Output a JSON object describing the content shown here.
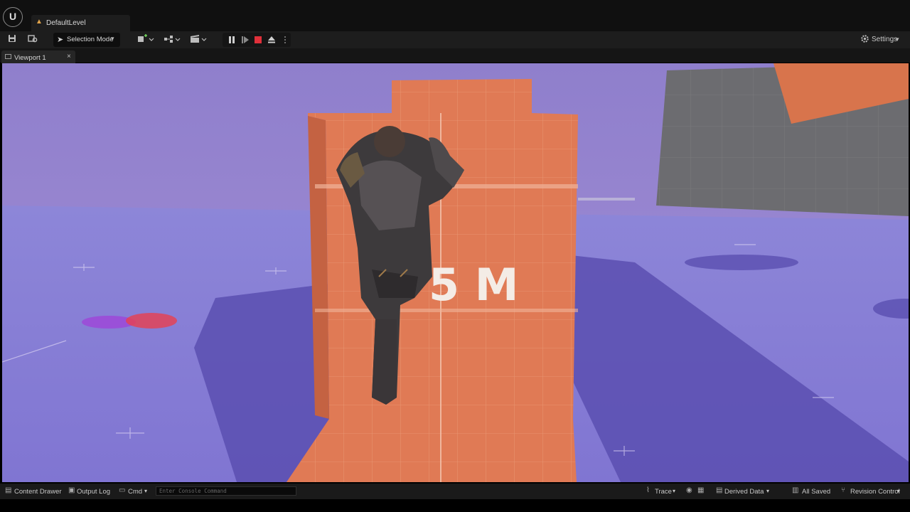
{
  "app": {
    "logo_text": "U",
    "level_title": "DefaultLevel"
  },
  "toolbar": {
    "mode_label": "Selection Mode",
    "settings_label": "Settings"
  },
  "viewport": {
    "tab_label": "Viewport 1",
    "close_glyph": "×",
    "sign_text": "5 M"
  },
  "statusbar": {
    "content_drawer": "Content Drawer",
    "output_log": "Output Log",
    "cmd": "Cmd",
    "console_placeholder": "Enter Console Command",
    "trace": "Trace",
    "derived_data": "Derived Data",
    "all_saved": "All Saved",
    "revision_control": "Revision Control"
  },
  "colors": {
    "floor": "#8a7fd6",
    "sky": "#9a84cf",
    "wall": "#e07a55",
    "stop": "#e0303a",
    "warning": "#e0a34a"
  }
}
